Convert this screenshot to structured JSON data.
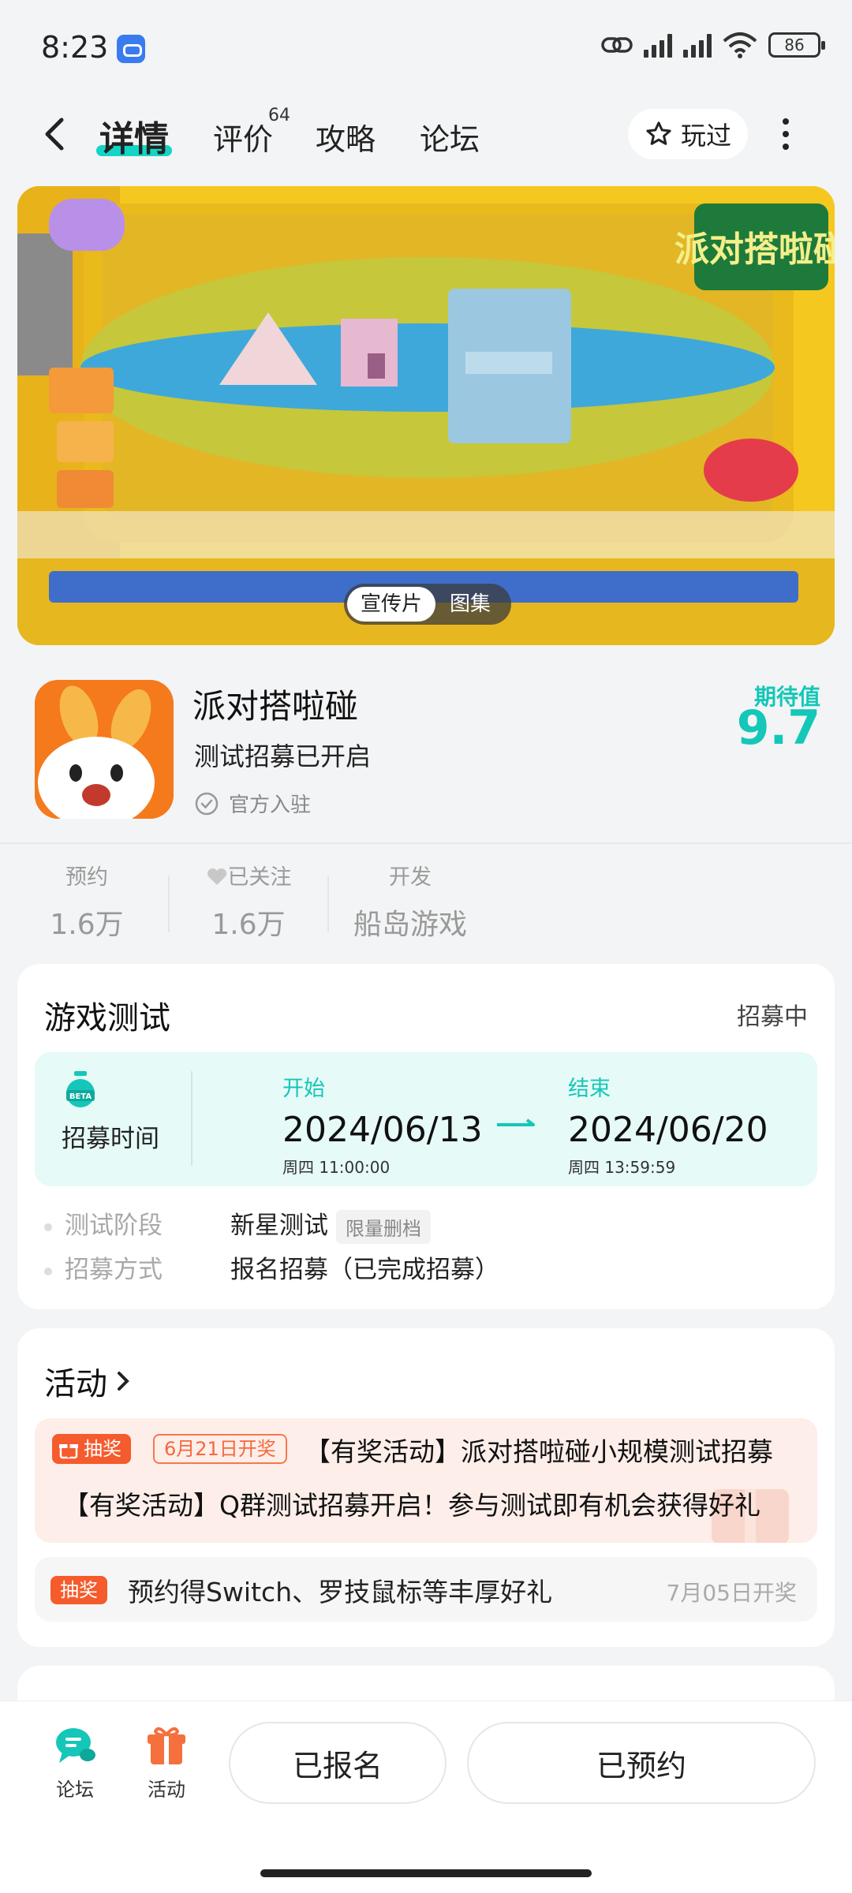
{
  "status_bar": {
    "time": "8:23",
    "battery": "86"
  },
  "header": {
    "tabs": [
      {
        "label": "详情"
      },
      {
        "label": "评价",
        "badge": "64"
      },
      {
        "label": "攻略"
      },
      {
        "label": "论坛"
      }
    ],
    "played_label": "玩过"
  },
  "media": {
    "logo_text": "派对搭啦碰",
    "toggle": [
      "宣传片",
      "图集"
    ]
  },
  "game": {
    "title": "派对搭啦碰",
    "subtitle": "测试招募已开启",
    "official": "官方入驻",
    "expect_label": "期待值",
    "expect_score": "9.7"
  },
  "stats": [
    {
      "key": "预约",
      "value": "1.6万"
    },
    {
      "key": "已关注",
      "value": "1.6万"
    },
    {
      "key": "开发",
      "value": "船岛游戏"
    }
  ],
  "test_card": {
    "title": "游戏测试",
    "status": "招募中",
    "recruit_label": "招募时间",
    "start": {
      "label": "开始",
      "date": "2024/06/13",
      "detail": "周四  11:00:00"
    },
    "end": {
      "label": "结束",
      "date": "2024/06/20",
      "detail": "周四  13:59:59"
    },
    "rows": [
      {
        "key": "测试阶段",
        "value": "新星测试",
        "tag": "限量删档"
      },
      {
        "key": "招募方式",
        "value": "报名招募（已完成招募）"
      }
    ]
  },
  "activity_card": {
    "title": "活动",
    "main": {
      "badge": "抽奖",
      "date_badge": "6月21日开奖",
      "title": "【有奖活动】派对搭啦碰小规模测试招募",
      "subtitle": "【有奖活动】Q群测试招募开启！参与测试即有机会获得好礼"
    },
    "second": {
      "badge": "抽奖",
      "text": "预约得Switch、罗技鼠标等丰厚好礼",
      "date": "7月05日开奖"
    }
  },
  "bottom_bar": {
    "forum_label": "论坛",
    "activity_label": "活动",
    "signed_label": "已报名",
    "reserved_label": "已预约"
  },
  "colors": {
    "accent": "#14c7b8",
    "lottery": "#f55b2c"
  }
}
